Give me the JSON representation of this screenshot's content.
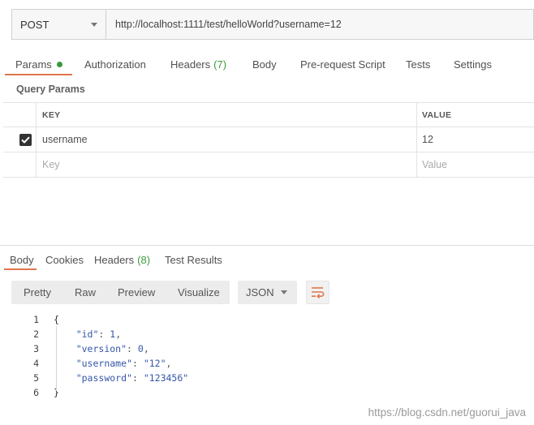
{
  "request": {
    "method": "POST",
    "url": "http://localhost:1111/test/helloWorld?username=12"
  },
  "request_tabs": [
    {
      "label": "Params",
      "count": ""
    },
    {
      "label": "Authorization",
      "count": ""
    },
    {
      "label": "Headers",
      "count": "(7)"
    },
    {
      "label": "Body",
      "count": ""
    },
    {
      "label": "Pre-request Script",
      "count": ""
    },
    {
      "label": "Tests",
      "count": ""
    },
    {
      "label": "Settings",
      "count": ""
    }
  ],
  "query_params": {
    "title": "Query Params",
    "headers": {
      "key": "KEY",
      "value": "VALUE"
    },
    "rows": [
      {
        "checked": true,
        "key": "username",
        "value": "12"
      }
    ],
    "placeholder": {
      "key": "Key",
      "value": "Value"
    }
  },
  "response_tabs": [
    {
      "label": "Body",
      "count": ""
    },
    {
      "label": "Cookies",
      "count": ""
    },
    {
      "label": "Headers",
      "count": "(8)"
    },
    {
      "label": "Test Results",
      "count": ""
    }
  ],
  "view_modes": [
    "Pretty",
    "Raw",
    "Preview",
    "Visualize"
  ],
  "format": "JSON",
  "code_lines": [
    {
      "n": "1",
      "t": "{"
    },
    {
      "n": "2",
      "k": "\"id\"",
      "v": "1",
      "c": ","
    },
    {
      "n": "3",
      "k": "\"version\"",
      "v": "0",
      "c": ","
    },
    {
      "n": "4",
      "k": "\"username\"",
      "v": "\"12\"",
      "c": ","
    },
    {
      "n": "5",
      "k": "\"password\"",
      "v": "\"123456\"",
      "c": ""
    },
    {
      "n": "6",
      "t": "}"
    }
  ],
  "watermark": "https://blog.csdn.net/guorui_java",
  "colors": {
    "accent": "#e0764c",
    "active_dot": "#3a9a3a",
    "count_green": "#3c9a3c",
    "json_value": "#3556a8"
  }
}
